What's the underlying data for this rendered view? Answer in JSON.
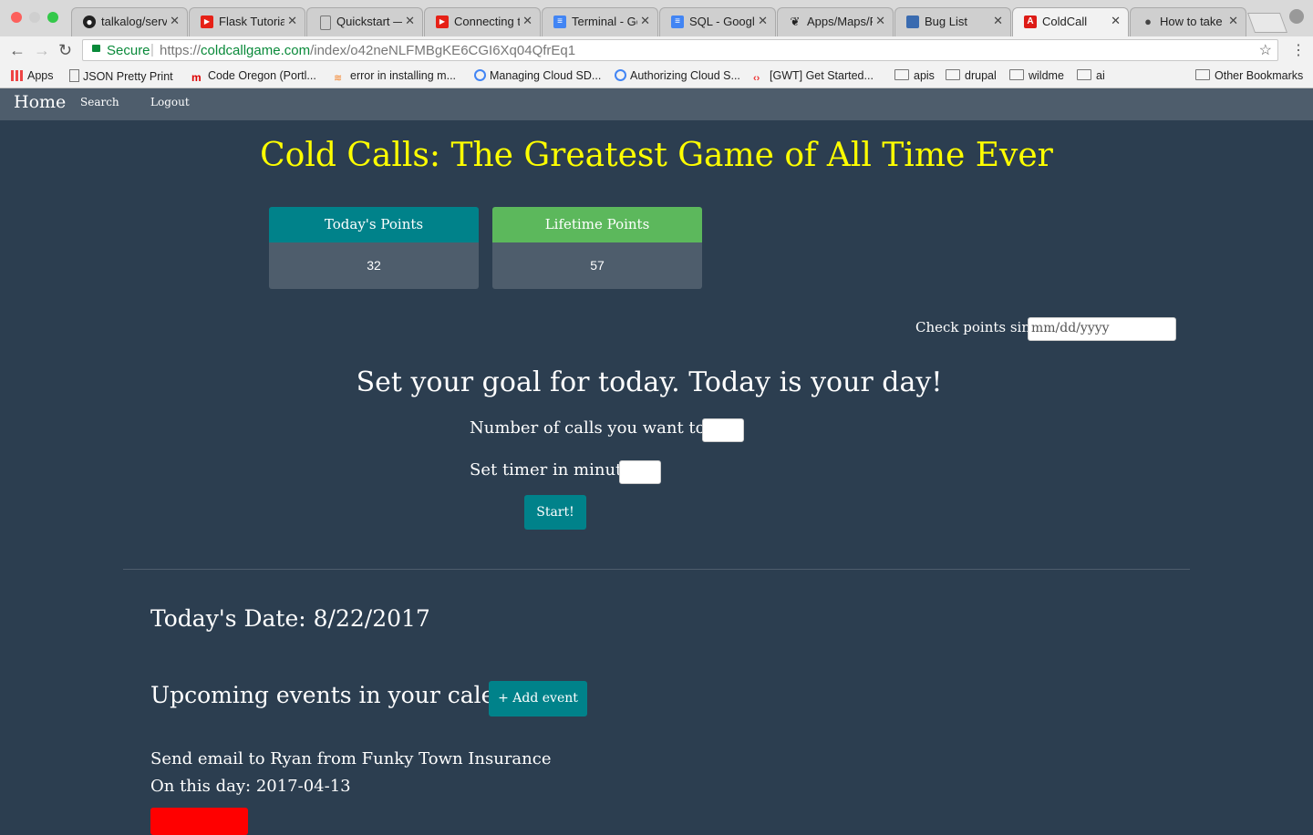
{
  "browser": {
    "tabs": [
      {
        "label": "talkalog/serv",
        "icon": "github-icon"
      },
      {
        "label": "Flask Tutorial",
        "icon": "youtube-icon"
      },
      {
        "label": "Quickstart —",
        "icon": "document-icon"
      },
      {
        "label": "Connecting t",
        "icon": "youtube-icon"
      },
      {
        "label": "Terminal - Go",
        "icon": "google-docs-icon"
      },
      {
        "label": "SQL - Google",
        "icon": "google-docs-icon"
      },
      {
        "label": "Apps/Maps/R",
        "icon": "gnome-icon"
      },
      {
        "label": "Bug List",
        "icon": "bugzilla-icon"
      },
      {
        "label": "ColdCall",
        "icon": "angular-icon"
      },
      {
        "label": "How to take a",
        "icon": "apple-icon"
      }
    ],
    "address": {
      "secure_label": "Secure",
      "scheme": "https://",
      "host": "coldcallgame.com",
      "path": "/index/o42neNLFMBgKE6CGI6Xq04QfrEq1"
    },
    "bookmarks": [
      {
        "label": "Apps",
        "icon": "apps-grid-icon"
      },
      {
        "label": "JSON Pretty Print",
        "icon": "page-icon"
      },
      {
        "label": "Code Oregon (Portl...",
        "icon": "m-logo-icon"
      },
      {
        "label": "error in installing m...",
        "icon": "stackoverflow-icon"
      },
      {
        "label": "Managing Cloud SD...",
        "icon": "google-cloud-icon"
      },
      {
        "label": "Authorizing Cloud S...",
        "icon": "google-cloud-icon"
      },
      {
        "label": "[GWT] Get Started...",
        "icon": "gwt-icon"
      },
      {
        "label": "apis",
        "icon": "folder-icon"
      },
      {
        "label": "drupal",
        "icon": "folder-icon"
      },
      {
        "label": "wildme",
        "icon": "folder-icon"
      },
      {
        "label": "ai",
        "icon": "folder-icon"
      },
      {
        "label": "Other Bookmarks",
        "icon": "folder-icon"
      }
    ]
  },
  "nav": {
    "home": "Home",
    "search": "Search",
    "logout": "Logout"
  },
  "page": {
    "title": "Cold Calls: The Greatest Game of All Time Ever",
    "todays_points": {
      "label": "Today's Points",
      "value": "32"
    },
    "lifetime_points": {
      "label": "Lifetime Points",
      "value": "57"
    },
    "since": {
      "label": "Check points since:",
      "placeholder": "mm/dd/yyyy"
    },
    "goal": {
      "heading": "Set your goal for today. Today is your day!",
      "calls_label": "Number of calls you want to do:",
      "timer_label": "Set timer in minutes:",
      "start_label": "Start!"
    },
    "todays_date": "Today's Date: 8/22/2017",
    "events": {
      "heading": "Upcoming events in your calendar",
      "add_label": "+ Add event",
      "items": [
        {
          "title": "Send email to Ryan from Funky Town Insurance",
          "date_line": "On this day: 2017-04-13"
        }
      ]
    }
  },
  "colors": {
    "title_yellow": "#ffff00",
    "teal": "#00828a",
    "green": "#5cb85c",
    "background": "#2c3e50",
    "navbar": "#4e5d6c",
    "danger_red": "#ff0000"
  }
}
